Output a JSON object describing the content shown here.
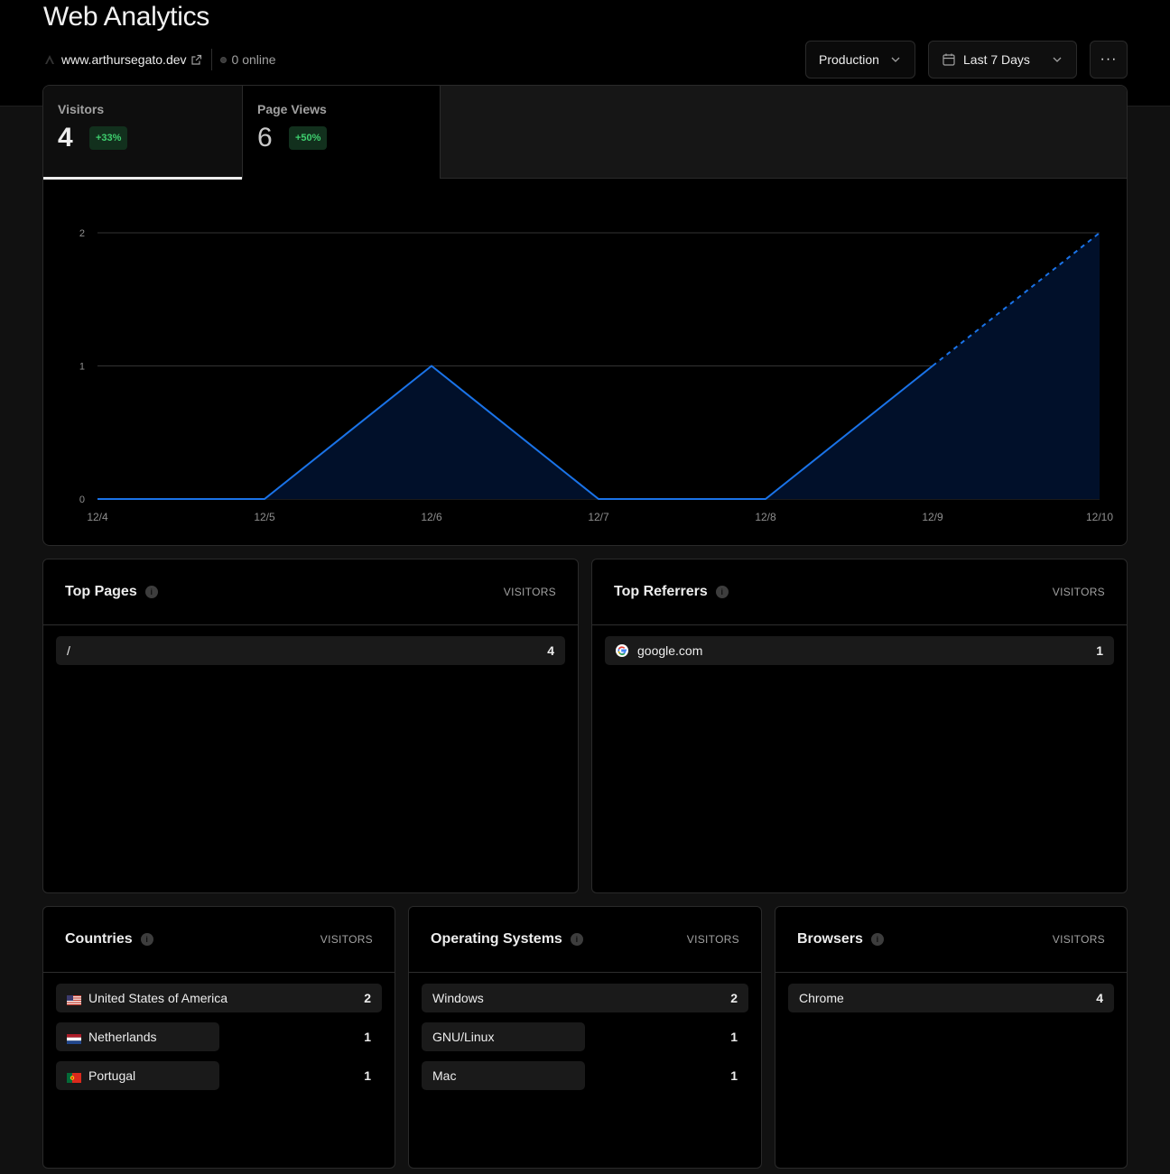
{
  "header": {
    "title": "Web Analytics",
    "site": "www.arthursegato.dev",
    "online": "0 online",
    "environment": "Production",
    "date_range": "Last 7 Days",
    "more_label": "···"
  },
  "tabs": [
    {
      "label": "Visitors",
      "value": "4",
      "change": "+33%",
      "active": true
    },
    {
      "label": "Page Views",
      "value": "6",
      "change": "+50%",
      "active": false
    }
  ],
  "chart_data": {
    "type": "area",
    "title": "Visitors",
    "x": [
      "12/4",
      "12/5",
      "12/6",
      "12/7",
      "12/8",
      "12/9",
      "12/10"
    ],
    "series": [
      {
        "name": "Visitors",
        "values": [
          0,
          0,
          1,
          0,
          0,
          1,
          2
        ]
      }
    ],
    "partial_last_segment": true,
    "yticks": [
      "0",
      "1",
      "2"
    ],
    "ylim": [
      0,
      2
    ],
    "grid": true,
    "line_color": "#1a73e8",
    "fill_color": "#01102a"
  },
  "panels": {
    "top_pages": {
      "title": "Top Pages",
      "column": "VISITORS",
      "rows": [
        {
          "label": "/",
          "value": "4",
          "share": 1.0
        }
      ]
    },
    "top_referrers": {
      "title": "Top Referrers",
      "column": "VISITORS",
      "rows": [
        {
          "label": "google.com",
          "icon": "google-icon",
          "value": "1",
          "share": 1.0
        }
      ]
    },
    "countries": {
      "title": "Countries",
      "column": "VISITORS",
      "rows": [
        {
          "label": "United States of America",
          "flag": "us-flag-icon",
          "value": "2",
          "share": 1.0
        },
        {
          "label": "Netherlands",
          "flag": "nl-flag-icon",
          "value": "1",
          "share": 0.5
        },
        {
          "label": "Portugal",
          "flag": "pt-flag-icon",
          "value": "1",
          "share": 0.5
        }
      ]
    },
    "operating_systems": {
      "title": "Operating Systems",
      "column": "VISITORS",
      "rows": [
        {
          "label": "Windows",
          "value": "2",
          "share": 1.0
        },
        {
          "label": "GNU/Linux",
          "value": "1",
          "share": 0.5
        },
        {
          "label": "Mac",
          "value": "1",
          "share": 0.5
        }
      ]
    },
    "browsers": {
      "title": "Browsers",
      "column": "VISITORS",
      "rows": [
        {
          "label": "Chrome",
          "value": "4",
          "share": 1.0
        }
      ]
    }
  }
}
